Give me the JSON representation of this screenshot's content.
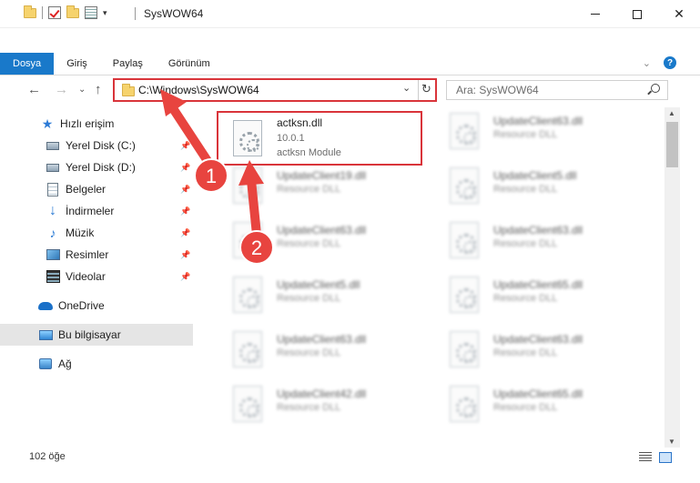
{
  "window": {
    "title": "SysWOW64",
    "buttons": [
      "minimize",
      "maximize",
      "close"
    ]
  },
  "ribbon": {
    "tabs": [
      {
        "label": "Dosya",
        "active": true
      },
      {
        "label": "Giriş"
      },
      {
        "label": "Paylaş"
      },
      {
        "label": "Görünüm"
      }
    ],
    "help": "?"
  },
  "address": {
    "path": "C:\\Windows\\SysWOW64",
    "search_placeholder": "Ara: SysWOW64"
  },
  "sidebar": {
    "items": [
      {
        "label": "Hızlı erişim",
        "icon": "star-icon"
      },
      {
        "label": "Yerel Disk (C:)",
        "icon": "disk-icon",
        "pinned": true
      },
      {
        "label": "Yerel Disk (D:)",
        "icon": "disk-icon",
        "pinned": true
      },
      {
        "label": "Belgeler",
        "icon": "documents-icon",
        "pinned": true
      },
      {
        "label": "İndirmeler",
        "icon": "downloads-icon",
        "pinned": true
      },
      {
        "label": "Müzik",
        "icon": "music-icon",
        "pinned": true
      },
      {
        "label": "Resimler",
        "icon": "pictures-icon",
        "pinned": true
      },
      {
        "label": "Videolar",
        "icon": "videos-icon",
        "pinned": true
      },
      {
        "label": "OneDrive",
        "icon": "onedrive-icon"
      },
      {
        "label": "Bu bilgisayar",
        "icon": "this-pc-icon",
        "selected": true
      },
      {
        "label": "Ağ",
        "icon": "network-icon"
      }
    ]
  },
  "files": {
    "featured": {
      "name": "actksn.dll",
      "version": "10.0.1",
      "description": "actksn Module"
    },
    "left": [
      {
        "name": "UpdateClient19.dll",
        "description": "Resource DLL"
      },
      {
        "name": "UpdateClient63.dll",
        "description": "Resource DLL"
      },
      {
        "name": "UpdateClient5.dll",
        "description": "Resource DLL"
      },
      {
        "name": "UpdateClient63.dll",
        "description": "Resource DLL"
      },
      {
        "name": "UpdateClient42.dll",
        "description": "Resource DLL"
      }
    ],
    "right": [
      {
        "name": "UpdateClient63.dll",
        "description": "Resource DLL"
      },
      {
        "name": "UpdateClient5.dll",
        "description": "Resource DLL"
      },
      {
        "name": "UpdateClient63.dll",
        "description": "Resource DLL"
      },
      {
        "name": "UpdateClient65.dll",
        "description": "Resource DLL"
      },
      {
        "name": "UpdateClient63.dll",
        "description": "Resource DLL"
      },
      {
        "name": "UpdateClient65.dll",
        "description": "Resource DLL"
      }
    ]
  },
  "status": {
    "item_count": "102 öğe"
  },
  "annotations": {
    "markers": [
      "1",
      "2"
    ],
    "color": "#e8443f"
  }
}
